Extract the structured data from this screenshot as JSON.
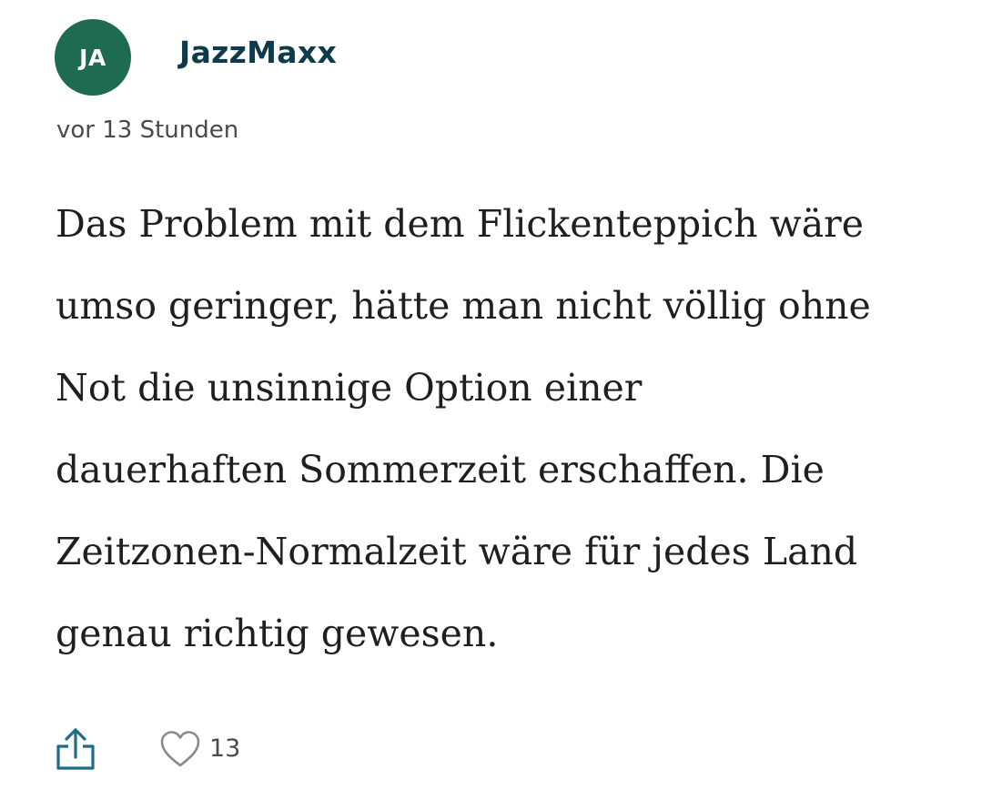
{
  "author": {
    "initials": "JA",
    "name": "JazzMaxx",
    "avatar_color": "#1f6b52",
    "name_color": "#0d3b4a"
  },
  "timestamp": "vor 13 Stunden",
  "comment": {
    "lines": [
      "Das Problem mit dem Flickenteppich wäre",
      "umso geringer, hätte man nicht völlig ohne",
      "Not die unsinnige Option einer",
      "dauerhaften Sommerzeit erschaffen. Die",
      "Zeitzonen-Normalzeit wäre für jedes Land",
      "genau richtig gewesen."
    ]
  },
  "actions": {
    "share_icon": "share-icon",
    "like_icon": "heart-icon",
    "like_count": "13"
  }
}
